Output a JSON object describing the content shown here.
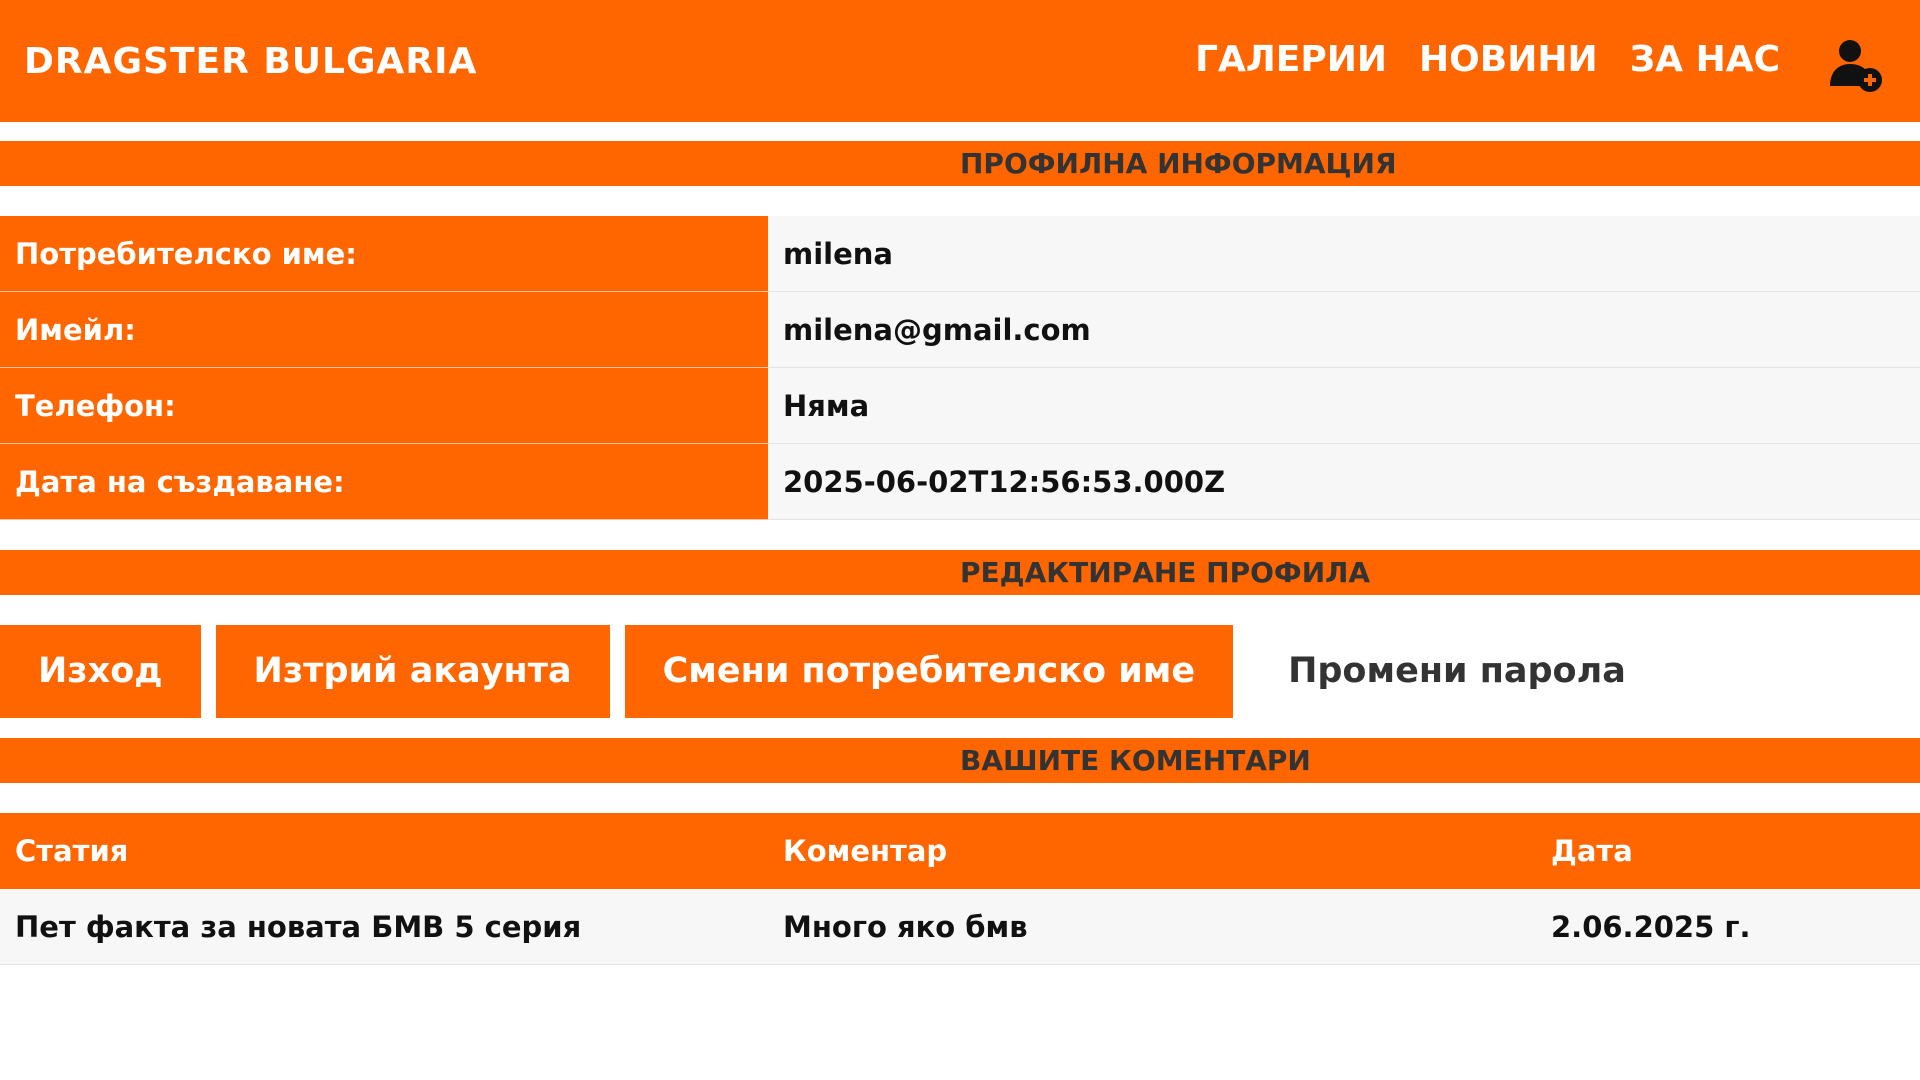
{
  "header": {
    "brand": "DRAGSTER BULGARIA",
    "nav": [
      "ГАЛЕРИИ",
      "НОВИНИ",
      "ЗА НАС"
    ],
    "user_icon": "user-plus-icon"
  },
  "profile": {
    "title": "ПРОФИЛНА ИНФОРМАЦИЯ",
    "rows": [
      {
        "label": "Потребителско име:",
        "value": "milena"
      },
      {
        "label": "Имейл:",
        "value": "milena@gmail.com"
      },
      {
        "label": "Телефон:",
        "value": "Няма"
      },
      {
        "label": "Дата на създаване:",
        "value": "2025-06-02T12:56:53.000Z"
      }
    ]
  },
  "edit": {
    "title": "РЕДАКТИРАНЕ ПРОФИЛА",
    "logout_label": "Изход",
    "delete_label": "Изтрий акаунта",
    "change_username_label": "Смени потребителско име",
    "change_password_label": "Промени парола"
  },
  "comments": {
    "title": "ВАШИТЕ КОМЕНТАРИ",
    "headers": [
      "Статия",
      "Коментар",
      "Дата"
    ],
    "rows": [
      {
        "article": "Пет факта за новата БМВ 5 серия",
        "comment": "Много яко бмв",
        "date": "2.06.2025 г."
      }
    ]
  },
  "colors": {
    "accent": "#ff6600",
    "row_bg": "#f7f7f7",
    "heading_text": "#333333"
  }
}
